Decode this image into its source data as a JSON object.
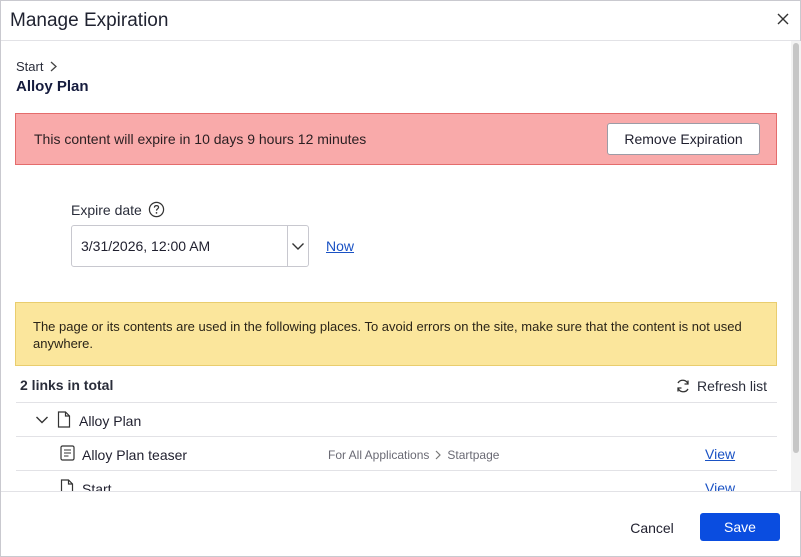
{
  "dialog": {
    "title": "Manage Expiration",
    "close_icon": "close-icon"
  },
  "breadcrumb": {
    "parent": "Start",
    "current": "Alloy Plan"
  },
  "alert": {
    "message": "This content will expire in 10 days 9 hours 12 minutes",
    "button_label": "Remove Expiration",
    "color": "#f9aaaa"
  },
  "expire": {
    "label": "Expire date",
    "value": "3/31/2026, 12:00 AM",
    "now_label": "Now"
  },
  "warning": {
    "message": "The page or its contents are used in the following places. To avoid errors on the site, make sure that the content is not used anywhere.",
    "color": "#fbe69c"
  },
  "links": {
    "total_label": "2 links in total",
    "refresh_label": "Refresh list",
    "rows": [
      {
        "label": "Alloy Plan",
        "icon": "page-icon",
        "expanded": true
      },
      {
        "label": "Alloy Plan teaser",
        "icon": "block-icon",
        "path": [
          "For All Applications",
          "Startpage"
        ],
        "view_label": "View"
      },
      {
        "label": "Start",
        "icon": "page-icon",
        "view_label": "View"
      }
    ]
  },
  "footer": {
    "cancel_label": "Cancel",
    "save_label": "Save",
    "accent": "#0a4de0"
  }
}
